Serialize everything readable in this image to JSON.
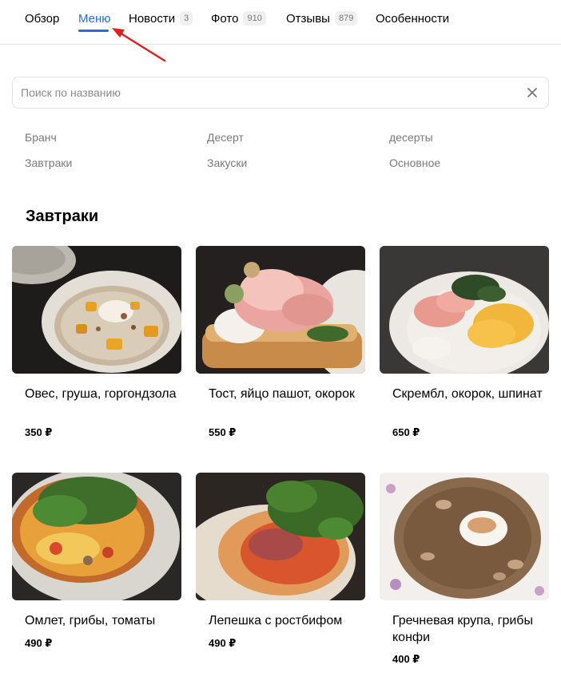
{
  "tabs": [
    {
      "label": "Обзор",
      "badge": null
    },
    {
      "label": "Меню",
      "badge": null,
      "active": true
    },
    {
      "label": "Новости",
      "badge": "3"
    },
    {
      "label": "Фото",
      "badge": "910"
    },
    {
      "label": "Отзывы",
      "badge": "879"
    },
    {
      "label": "Особенности",
      "badge": null
    }
  ],
  "search": {
    "placeholder": "Поиск по названию",
    "value": ""
  },
  "categories": [
    "Бранч",
    "Десерт",
    "десерты",
    "Завтраки",
    "Закуски",
    "Основное"
  ],
  "section": {
    "title": "Завтраки"
  },
  "items": [
    {
      "name": "Овес, груша, горгондзола",
      "price": "350 ₽"
    },
    {
      "name": "Тост, яйцо пашот, окорок",
      "price": "550 ₽"
    },
    {
      "name": "Скрембл, окорок, шпинат",
      "price": "650 ₽"
    },
    {
      "name": "Омлет, грибы, томаты",
      "price": "490 ₽"
    },
    {
      "name": "Лепешка с ростбифом",
      "price": "490 ₽"
    },
    {
      "name": "Гречневая крупа, грибы конфи",
      "price": "400 ₽"
    }
  ],
  "colors": {
    "accent": "#1f6fdc",
    "annotation_arrow": "#e02020"
  },
  "icons": {
    "clear": "close-icon",
    "annotation": "red-arrow-icon"
  }
}
